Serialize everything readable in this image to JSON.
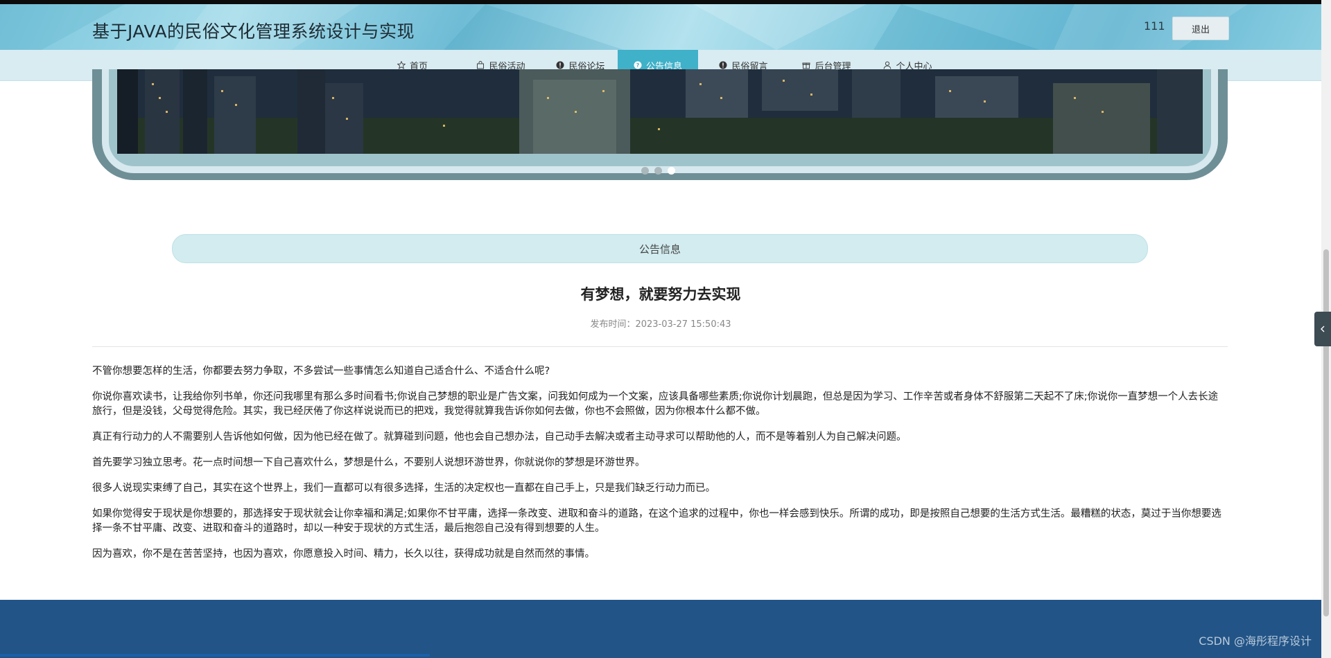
{
  "header": {
    "title": "基于JAVA的民俗文化管理系统设计与实现",
    "username": "111",
    "logout_label": "退出"
  },
  "nav": {
    "items": [
      {
        "label": "首页",
        "icon": "star-icon"
      },
      {
        "label": "民俗活动",
        "icon": "bag-icon"
      },
      {
        "label": "民俗论坛",
        "icon": "info-icon"
      },
      {
        "label": "公告信息",
        "icon": "question-icon",
        "active": true
      },
      {
        "label": "民俗留言",
        "icon": "info-icon"
      },
      {
        "label": "后台管理",
        "icon": "gift-icon"
      },
      {
        "label": "个人中心",
        "icon": "user-icon"
      }
    ]
  },
  "carousel": {
    "slide_count": 3,
    "active_index": 2
  },
  "section": {
    "label": "公告信息"
  },
  "notice": {
    "title": "有梦想，就要努力去实现",
    "publish_time": "发布时间：2023-03-27 15:50:43",
    "paragraphs": [
      "不管你想要怎样的生活，你都要去努力争取，不多尝试一些事情怎么知道自己适合什么、不适合什么呢?",
      "你说你喜欢读书，让我给你列书单，你还问我哪里有那么多时间看书;你说自己梦想的职业是广告文案，问我如何成为一个文案，应该具备哪些素质;你说你计划晨跑，但总是因为学习、工作辛苦或者身体不舒服第二天起不了床;你说你一直梦想一个人去长途旅行，但是没钱，父母觉得危险。其实，我已经厌倦了你这样说说而已的把戏，我觉得就算我告诉你如何去做，你也不会照做，因为你根本什么都不做。",
      "真正有行动力的人不需要别人告诉他如何做，因为他已经在做了。就算碰到问题，他也会自己想办法，自己动手去解决或者主动寻求可以帮助他的人，而不是等着别人为自己解决问题。",
      "首先要学习独立思考。花一点时间想一下自己喜欢什么，梦想是什么，不要别人说想环游世界，你就说你的梦想是环游世界。",
      "很多人说现实束缚了自己，其实在这个世界上，我们一直都可以有很多选择，生活的决定权也一直都在自己手上，只是我们缺乏行动力而已。",
      "如果你觉得安于现状是你想要的，那选择安于现状就会让你幸福和满足;如果你不甘平庸，选择一条改变、进取和奋斗的道路，在这个追求的过程中，你也一样会感到快乐。所谓的成功，即是按照自己想要的生活方式生活。最糟糕的状态，莫过于当你想要选择一条不甘平庸、改变、进取和奋斗的道路时，却以一种安于现状的方式生活，最后抱怨自己没有得到想要的人生。",
      "因为喜欢，你不是在苦苦坚持，也因为喜欢，你愿意投入时间、精力，长久以往，获得成功就是自然而然的事情。"
    ]
  },
  "watermark": "CSDN @海彤程序设计",
  "colors": {
    "nav_active": "#3fb1c9",
    "footer": "#225487",
    "section_bar": "#d2ecef"
  }
}
